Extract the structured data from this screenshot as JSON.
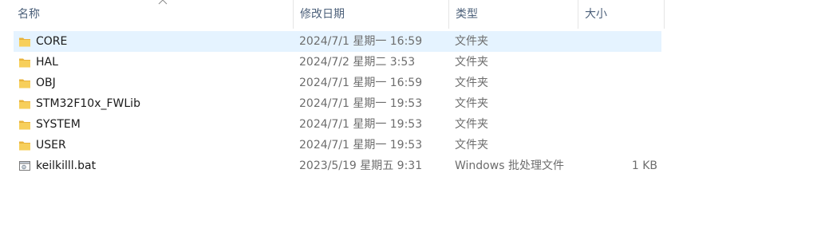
{
  "columns": {
    "name": "名称",
    "modified": "修改日期",
    "type": "类型",
    "size": "大小"
  },
  "sort_indicator": "sort-ascending-icon",
  "accent": "#e5f3ff",
  "folder_color": "#f4c542",
  "files": [
    {
      "icon": "folder-icon",
      "name": "CORE",
      "modified": "2024/7/1 星期一 16:59",
      "type": "文件夹",
      "size": "",
      "selected": true
    },
    {
      "icon": "folder-icon",
      "name": "HAL",
      "modified": "2024/7/2 星期二 3:53",
      "type": "文件夹",
      "size": ""
    },
    {
      "icon": "folder-icon",
      "name": "OBJ",
      "modified": "2024/7/1 星期一 16:59",
      "type": "文件夹",
      "size": ""
    },
    {
      "icon": "folder-icon",
      "name": "STM32F10x_FWLib",
      "modified": "2024/7/1 星期一 19:53",
      "type": "文件夹",
      "size": ""
    },
    {
      "icon": "folder-icon",
      "name": "SYSTEM",
      "modified": "2024/7/1 星期一 19:53",
      "type": "文件夹",
      "size": ""
    },
    {
      "icon": "folder-icon",
      "name": "USER",
      "modified": "2024/7/1 星期一 19:53",
      "type": "文件夹",
      "size": ""
    },
    {
      "icon": "batch-file-icon",
      "name": "keilkilll.bat",
      "modified": "2023/5/19 星期五 9:31",
      "type": "Windows 批处理文件",
      "size": "1 KB"
    }
  ]
}
